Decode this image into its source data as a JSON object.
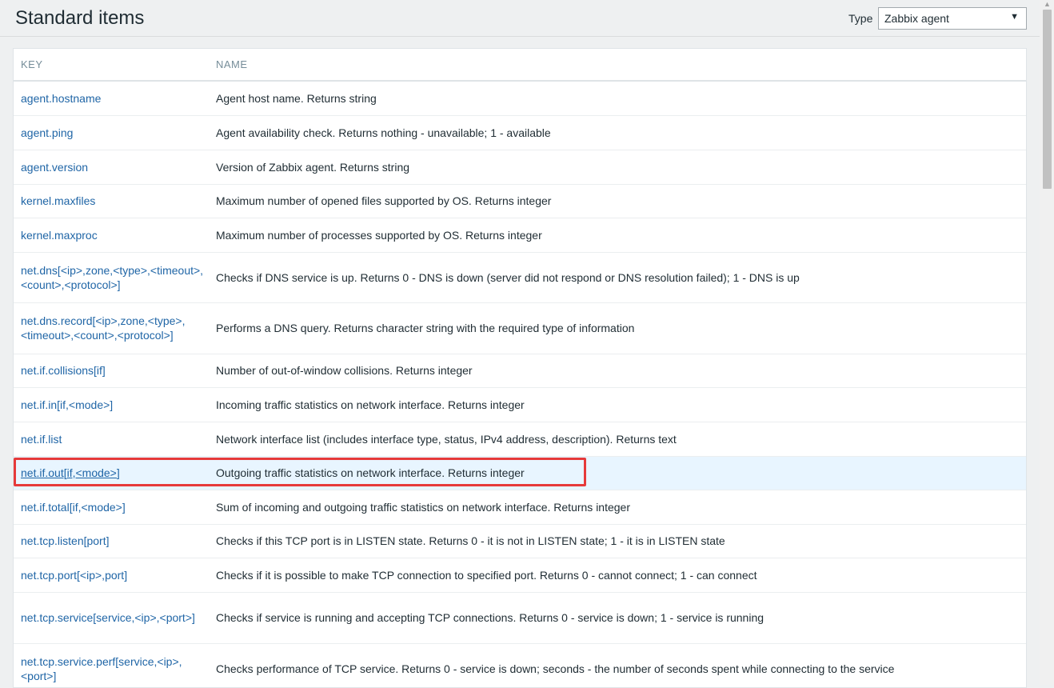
{
  "header": {
    "title": "Standard items",
    "type_label": "Type",
    "type_selected": "Zabbix agent"
  },
  "table": {
    "columns": [
      "KEY",
      "NAME"
    ],
    "rows": [
      {
        "key": "agent.hostname",
        "name": "Agent host name. Returns string"
      },
      {
        "key": "agent.ping",
        "name": "Agent availability check. Returns nothing - unavailable; 1 - available"
      },
      {
        "key": "agent.version",
        "name": "Version of Zabbix agent. Returns string"
      },
      {
        "key": "kernel.maxfiles",
        "name": "Maximum number of opened files supported by OS. Returns integer"
      },
      {
        "key": "kernel.maxproc",
        "name": "Maximum number of processes supported by OS. Returns integer"
      },
      {
        "key": "net.dns[<ip>,zone,<type>,<timeout>,<count>,<protocol>]",
        "name": "Checks if DNS service is up. Returns 0 - DNS is down (server did not respond or DNS resolution failed); 1 - DNS is up"
      },
      {
        "key": "net.dns.record[<ip>,zone,<type>,<timeout>,<count>,<protocol>]",
        "name": "Performs a DNS query. Returns character string with the required type of information"
      },
      {
        "key": "net.if.collisions[if]",
        "name": "Number of out-of-window collisions. Returns integer"
      },
      {
        "key": "net.if.in[if,<mode>]",
        "name": "Incoming traffic statistics on network interface. Returns integer"
      },
      {
        "key": "net.if.list",
        "name": "Network interface list (includes interface type, status, IPv4 address, description). Returns text"
      },
      {
        "key": "net.if.out[if,<mode>]",
        "name": "Outgoing traffic statistics on network interface. Returns integer"
      },
      {
        "key": "net.if.total[if,<mode>]",
        "name": "Sum of incoming and outgoing traffic statistics on network interface. Returns integer"
      },
      {
        "key": "net.tcp.listen[port]",
        "name": "Checks if this TCP port is in LISTEN state. Returns 0 - it is not in LISTEN state; 1 - it is in LISTEN state"
      },
      {
        "key": "net.tcp.port[<ip>,port]",
        "name": "Checks if it is possible to make TCP connection to specified port. Returns 0 - cannot connect; 1 - can connect"
      },
      {
        "key": "net.tcp.service[service,<ip>,<port>]",
        "name": "Checks if service is running and accepting TCP connections. Returns 0 - service is down; 1 - service is running"
      },
      {
        "key": "net.tcp.service.perf[service,<ip>,<port>]",
        "name": "Checks performance of TCP service. Returns 0 - service is down; seconds - the number of seconds spent while connecting to the service"
      }
    ]
  },
  "colors": {
    "link": "#1f65a6",
    "highlight_border": "#e63a3a",
    "selected_row_bg": "#e8f5ff"
  }
}
